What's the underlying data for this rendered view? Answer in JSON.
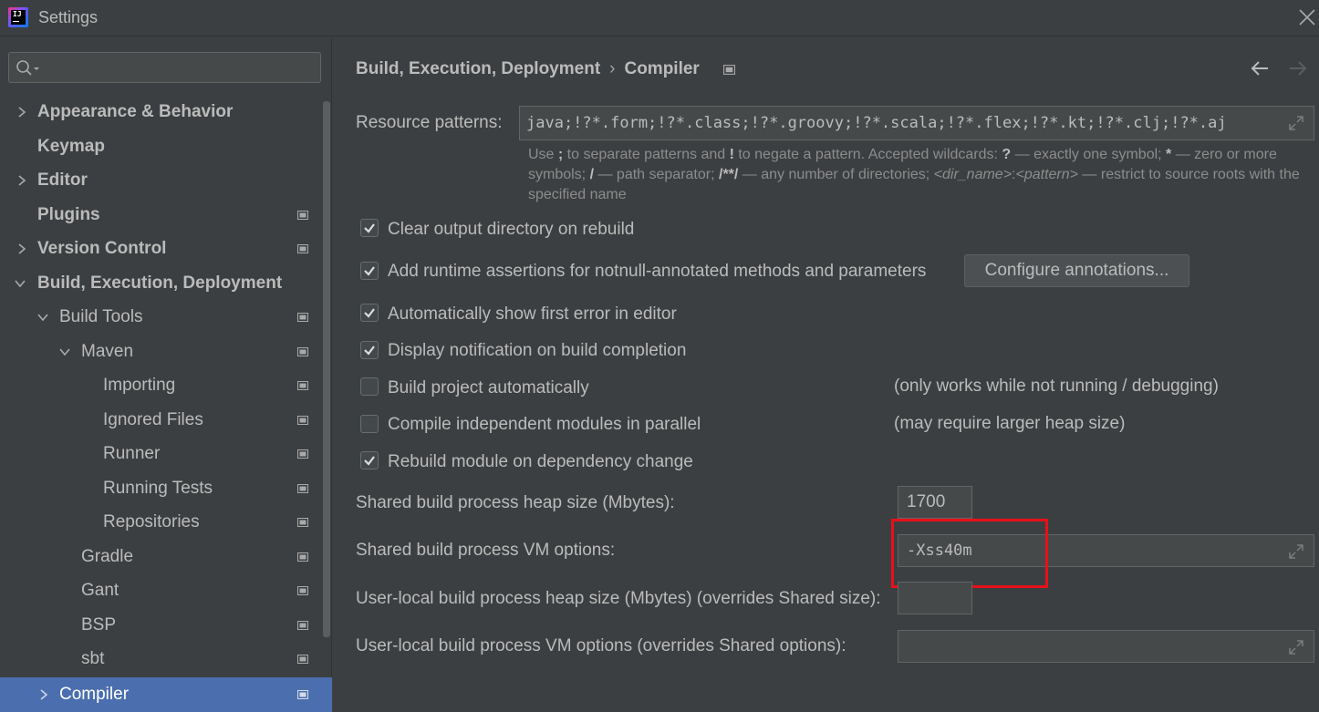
{
  "window": {
    "title": "Settings",
    "logo_text": "IJ"
  },
  "search": {
    "placeholder": ""
  },
  "sidebar": {
    "items": [
      {
        "label": "Appearance & Behavior",
        "expanded": false
      },
      {
        "label": "Keymap"
      },
      {
        "label": "Editor",
        "expanded": false
      },
      {
        "label": "Plugins"
      },
      {
        "label": "Version Control",
        "expanded": false
      },
      {
        "label": "Build, Execution, Deployment",
        "expanded": true
      },
      {
        "label": "Build Tools",
        "expanded": true
      },
      {
        "label": "Maven",
        "expanded": true
      },
      {
        "label": "Importing"
      },
      {
        "label": "Ignored Files"
      },
      {
        "label": "Runner"
      },
      {
        "label": "Running Tests"
      },
      {
        "label": "Repositories"
      },
      {
        "label": "Gradle"
      },
      {
        "label": "Gant"
      },
      {
        "label": "BSP"
      },
      {
        "label": "sbt"
      },
      {
        "label": "Compiler",
        "selected": true
      }
    ]
  },
  "breadcrumb": {
    "parent": "Build, Execution, Deployment",
    "separator": "›",
    "current": "Compiler"
  },
  "compiler": {
    "resource_patterns_label": "Resource patterns:",
    "resource_patterns_value": "java;!?*.form;!?*.class;!?*.groovy;!?*.scala;!?*.flex;!?*.kt;!?*.clj;!?*.aj",
    "hint": {
      "p1": "Use ",
      "semicolon": ";",
      "p2": " to separate patterns and ",
      "bang": "!",
      "p3": " to negate a pattern. Accepted wildcards: ",
      "q": "?",
      "p4": " — exactly one symbol; ",
      "star": "*",
      "p5": " — zero or more symbols; ",
      "slash": "/",
      "p6": " — path separator; ",
      "dstar": "/**/",
      "p7": " — any number of directories; ",
      "dir": "<dir_name>",
      "colon": ":",
      "pat": "<pattern>",
      "p8": " — restrict to source roots with the specified name"
    },
    "options": [
      {
        "label": "Clear output directory on rebuild",
        "checked": true
      },
      {
        "label": "Add runtime assertions for notnull-annotated methods and parameters",
        "checked": true
      },
      {
        "label": "Automatically show first error in editor",
        "checked": true
      },
      {
        "label": "Display notification on build completion",
        "checked": true
      },
      {
        "label": "Build project automatically",
        "checked": false,
        "note": "(only works while not running / debugging)"
      },
      {
        "label": "Compile independent modules in parallel",
        "checked": false,
        "note": "(may require larger heap size)"
      },
      {
        "label": "Rebuild module on dependency change",
        "checked": true
      }
    ],
    "configure_button": "Configure annotations...",
    "shared_heap_label": "Shared build process heap size (Mbytes):",
    "shared_heap_value": "1700",
    "shared_vm_label": "Shared build process VM options:",
    "shared_vm_value": "-Xss40m",
    "user_heap_label": "User-local build process heap size (Mbytes) (overrides Shared size):",
    "user_heap_value": "",
    "user_vm_label": "User-local build process VM options (overrides Shared options):",
    "user_vm_value": ""
  },
  "colors": {
    "background": "#3c3f41",
    "selection": "#4b6eaf",
    "highlight_box": "#e8101a"
  },
  "icons": {
    "search": "search-icon",
    "close": "close-icon",
    "back": "arrow-left-icon",
    "forward": "arrow-right-icon",
    "expand": "expand-icon",
    "project_scope": "project-scope-icon"
  }
}
